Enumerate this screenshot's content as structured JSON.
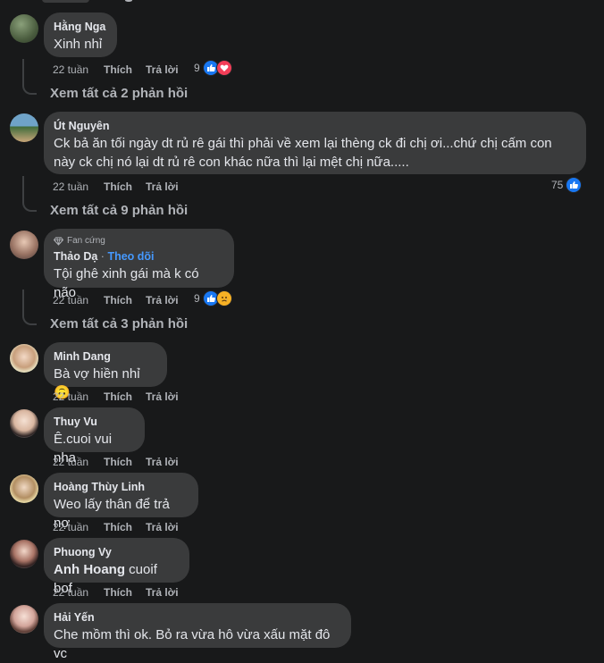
{
  "comments": [
    {
      "author": "Hằng Nga",
      "text": "Xinh nhỉ",
      "time": "22 tuần",
      "like": "Thích",
      "reply": "Trả lời",
      "reaction_count": "9",
      "reactions": [
        "like",
        "love"
      ],
      "view_replies": "Xem tất cả 2 phản hồi"
    },
    {
      "author": "Út Nguyên",
      "text": "Ck bả ăn tối ngày dt rủ rê gái thì phải về xem lại thèng ck đi chị ơi...chứ chị cấm con này ck chị nó lại dt rủ rê con khác nữa thì lại mệt chị nữa.....",
      "time": "22 tuần",
      "like": "Thích",
      "reply": "Trả lời",
      "reaction_count": "75",
      "reactions": [
        "like"
      ],
      "view_replies": "Xem tất cả 9 phản hồi"
    },
    {
      "badge": "Fan cứng",
      "author": "Thảo Dạ",
      "follow_sep": "·",
      "follow": "Theo dõi",
      "text": "Tội ghê xinh gái mà k có não",
      "time": "22 tuần",
      "like": "Thích",
      "reply": "Trả lời",
      "reaction_count": "9",
      "reactions": [
        "like",
        "sad"
      ],
      "view_replies": "Xem tất cả 3 phản hồi"
    },
    {
      "author": "Minh Dang",
      "text": "Bà vợ hiền nhỉ",
      "emoji": "🙃",
      "time": "22 tuần",
      "like": "Thích",
      "reply": "Trả lời"
    },
    {
      "author": "Thuy Vu",
      "text": "Ê.cuoi vui nha",
      "time": "22 tuần",
      "like": "Thích",
      "reply": "Trả lời"
    },
    {
      "author": "Hoàng Thùy Linh",
      "text": "Weo lấy thân để trả nợ",
      "time": "22 tuần",
      "like": "Thích",
      "reply": "Trả lời"
    },
    {
      "author": "Phuong Vy",
      "mention": "Anh Hoang",
      "text": "cuoif bof",
      "time": "22 tuần",
      "like": "Thích",
      "reply": "Trả lời"
    },
    {
      "author": "Hải Yến",
      "text": "Che mồm thì ok. Bỏ ra vừa hô vừa xấu mặt đô vc"
    }
  ],
  "colors": {
    "background": "#18191a",
    "bubble": "#3a3b3c",
    "like": "#1877f2",
    "love": "#f33e58",
    "follow": "#4599ff"
  }
}
